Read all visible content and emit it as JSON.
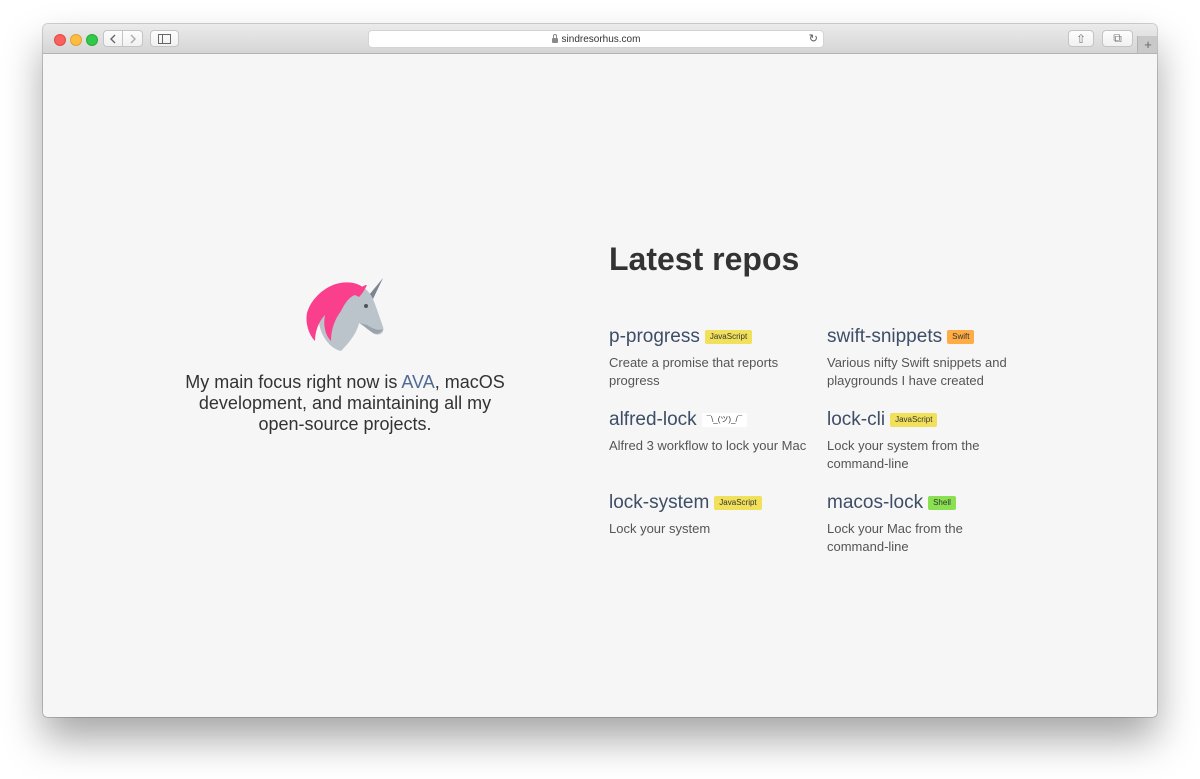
{
  "browser": {
    "url": "sindresorhus.com",
    "back_icon": "chevron-left-icon",
    "forward_icon": "chevron-right-icon",
    "reload_glyph": "↻",
    "share_glyph": "⇧",
    "tabs_glyph": "⧉",
    "newtab_glyph": "+"
  },
  "intro": {
    "text_before": "My main focus right now is ",
    "link": "AVA",
    "text_after": ", macOS development, and maintaining all my open-source projects."
  },
  "repos": {
    "title": "Latest repos",
    "items": [
      {
        "name": "p-progress",
        "badge": "JavaScript",
        "badge_color": "#f1e05a",
        "description": "Create a promise that reports progress"
      },
      {
        "name": "swift-snippets",
        "badge": "Swift",
        "badge_color": "#ffac45",
        "description": "Various nifty Swift snippets and playgrounds I have created"
      },
      {
        "name": "alfred-lock",
        "badge": "¯\\_(ツ)_/¯",
        "badge_color": "#ffffff",
        "description": "Alfred 3 workflow to lock your Mac"
      },
      {
        "name": "lock-cli",
        "badge": "JavaScript",
        "badge_color": "#f1e05a",
        "description": "Lock your system from the command-line"
      },
      {
        "name": "lock-system",
        "badge": "JavaScript",
        "badge_color": "#f1e05a",
        "description": "Lock your system"
      },
      {
        "name": "macos-lock",
        "badge": "Shell",
        "badge_color": "#89e051",
        "description": "Lock your Mac from the command-line"
      }
    ]
  }
}
